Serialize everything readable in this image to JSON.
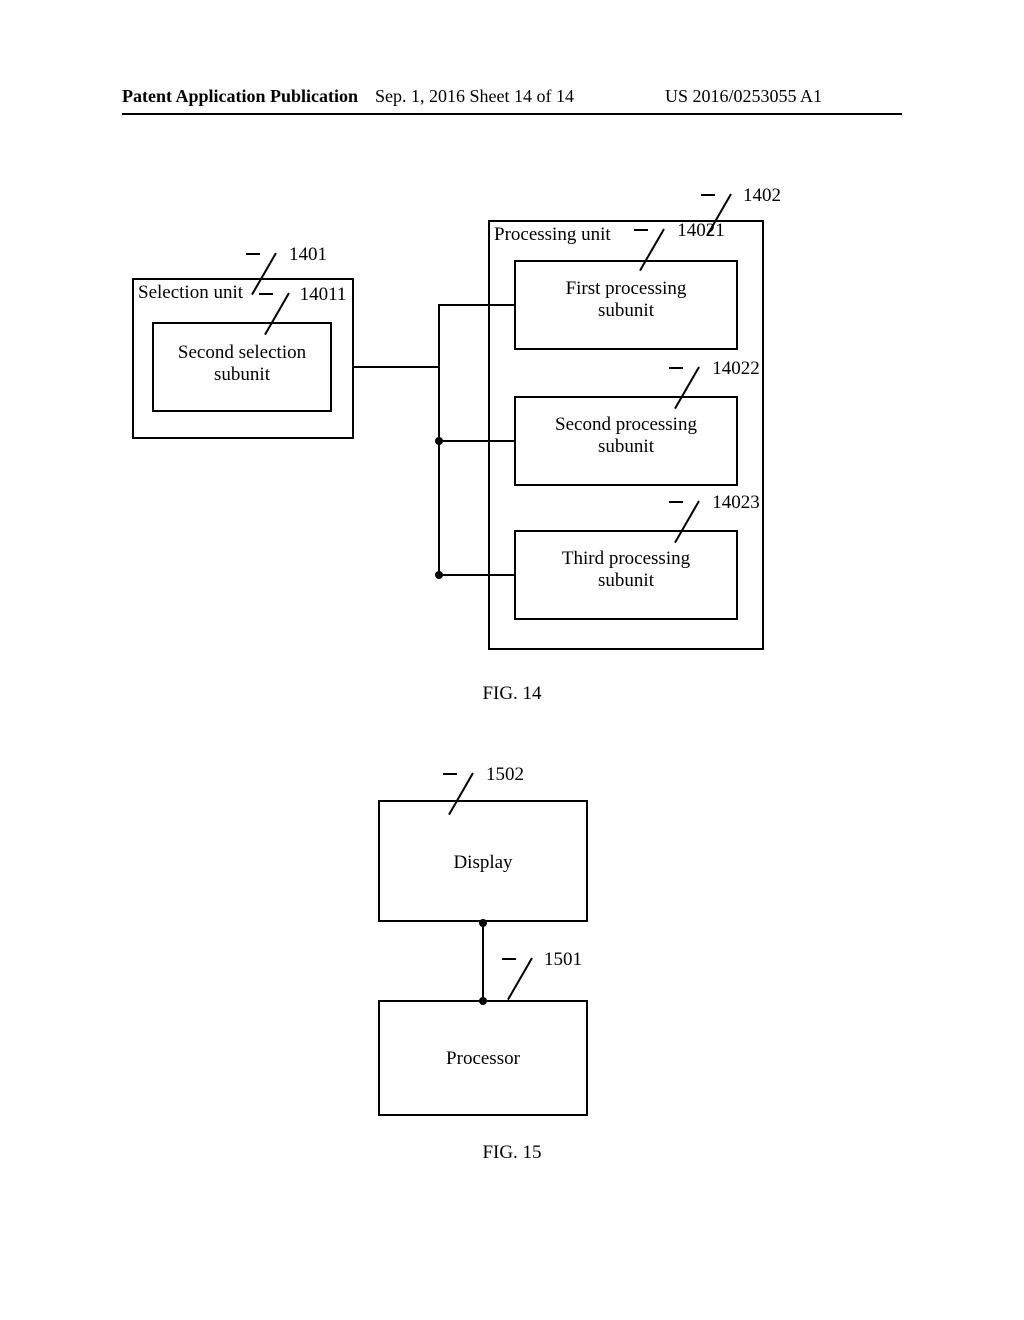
{
  "header": {
    "left": "Patent Application Publication",
    "mid": "Sep. 1, 2016   Sheet 14 of 14",
    "right": "US 2016/0253055 A1"
  },
  "fig14": {
    "selection_unit": "Selection unit",
    "selection_unit_ref": "1401",
    "second_selection_subunit": "Second selection\nsubunit",
    "second_selection_subunit_ref": "14011",
    "processing_unit": "Processing unit",
    "processing_unit_ref": "1402",
    "first_processing_subunit": "First processing\nsubunit",
    "first_processing_subunit_ref": "14021",
    "second_processing_subunit": "Second processing\nsubunit",
    "second_processing_subunit_ref": "14022",
    "third_processing_subunit": "Third processing\nsubunit",
    "third_processing_subunit_ref": "14023",
    "caption": "FIG. 14"
  },
  "fig15": {
    "display": "Display",
    "display_ref": "1502",
    "processor": "Processor",
    "processor_ref": "1501",
    "caption": "FIG. 15"
  }
}
